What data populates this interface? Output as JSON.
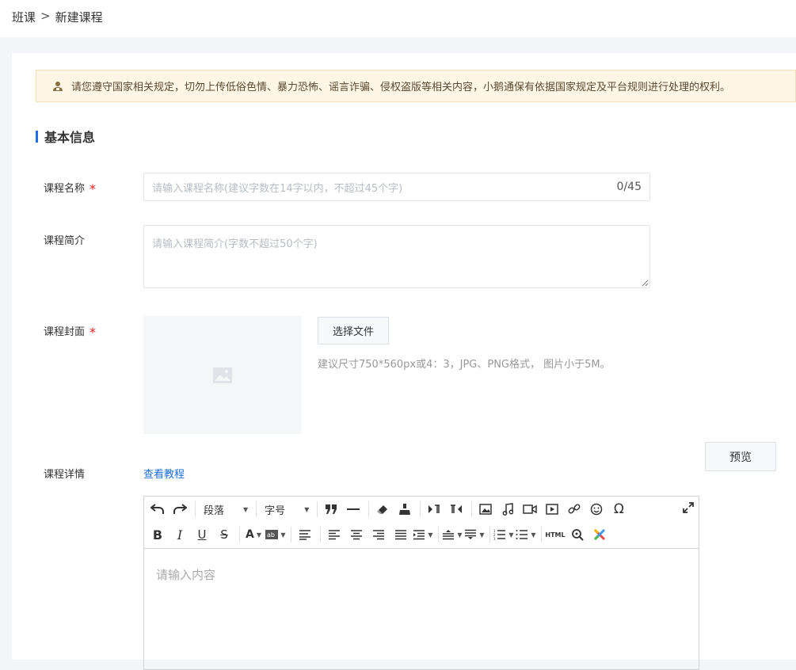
{
  "breadcrumb": {
    "parent": "班课",
    "separator": ">",
    "current": "新建课程"
  },
  "notice": {
    "text": "请您遵守国家相关规定，切勿上传低俗色情、暴力恐怖、谣言诈骗、侵权盗版等相关内容，小鹅通保有依据国家规定及平台规则进行处理的权利。"
  },
  "section": {
    "title": "基本信息"
  },
  "form": {
    "name": {
      "label": "课程名称",
      "required": "*",
      "placeholder": "请输入课程名称(建议字数在14字以内，不超过45个字)",
      "counter": "0/45"
    },
    "intro": {
      "label": "课程简介",
      "placeholder": "请输入课程简介(字数不超过50个字)"
    },
    "cover": {
      "label": "课程封面",
      "required": "*",
      "button": "选择文件",
      "hint": "建议尺寸750*560px或4：3，JPG、PNG格式， 图片小于5M。"
    },
    "detail": {
      "label": "课程详情",
      "tutorial_link": "查看教程"
    }
  },
  "editor": {
    "paragraph_dropdown": "段落",
    "font_size_dropdown": "字号",
    "html_button": "HTML",
    "placeholder": "请输入内容",
    "preview_button": "预览"
  },
  "colors": {
    "accent": "#1f6ee8",
    "required": "#e02020",
    "notice_bg": "#fff6e5"
  }
}
